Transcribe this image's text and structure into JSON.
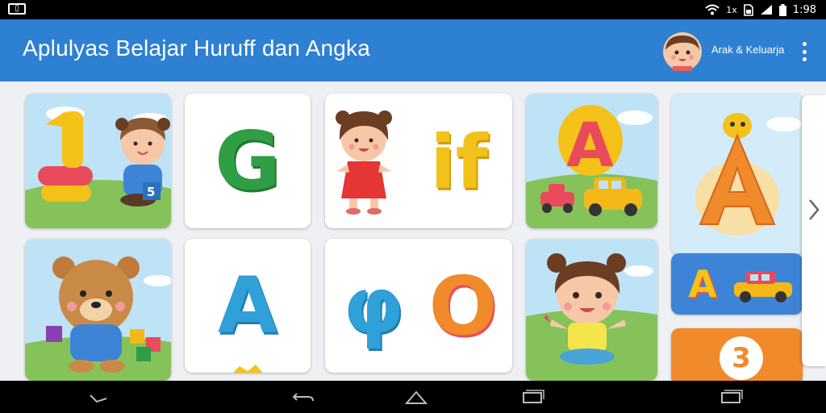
{
  "status_bar": {
    "left_icon": "app-notification-icon",
    "icons": [
      "wifi-icon",
      "signal-alt-icon",
      "sim-icon",
      "cell-signal-icon",
      "battery-icon"
    ],
    "signal_label": "1x",
    "time": "1:98"
  },
  "app_bar": {
    "title": "Aplulyas Belajar Huruff dan Angka",
    "profile_label": "Arak & Keluarja",
    "menu_icon": "more-vert-icon"
  },
  "cards": {
    "c1": {
      "letter": "1"
    },
    "c2": {
      "letter": "G"
    },
    "c3": {
      "letter": "if"
    },
    "c4": {
      "letter": "A"
    },
    "c5": {
      "letter": "A"
    },
    "c6": {
      "letter": "A"
    },
    "c7": {
      "letter": "φ"
    },
    "c8": {
      "letter": "O"
    },
    "c9": {
      "letter": "A"
    },
    "c10": {
      "letter": "3"
    }
  },
  "nav_bar": {
    "icons": [
      "back-alt-icon",
      "back-icon",
      "home-icon",
      "recents-icon",
      "recents-alt-icon"
    ]
  },
  "colors": {
    "app_bar": "#2d80d2",
    "background": "#eef0f3",
    "green": "#2f9e44",
    "blue": "#2fa0d8",
    "yellow": "#f2c21a",
    "red": "#e94b5b",
    "orange": "#f08a2a"
  }
}
